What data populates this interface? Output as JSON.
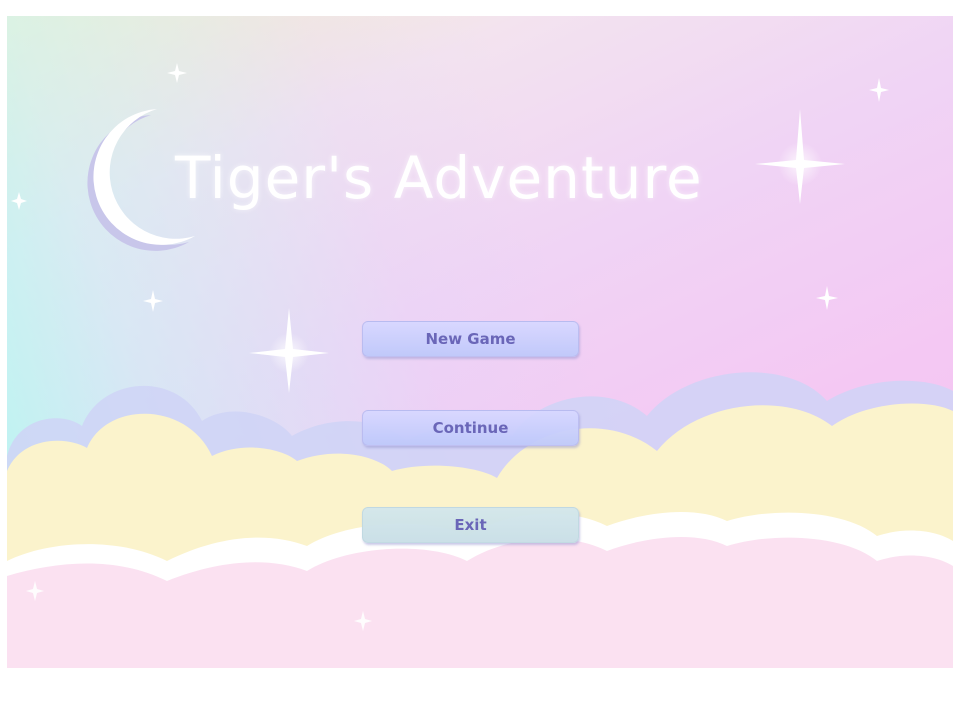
{
  "game": {
    "title": "Tiger's Adventure"
  },
  "menu": {
    "new_game": "New Game",
    "continue": "Continue",
    "exit": "Exit"
  },
  "colors": {
    "title_text": "#ffffff",
    "button_text": "#6a66b8",
    "cloud_blue": "#c9d0f5",
    "cloud_yellow": "#fbf4cf",
    "cloud_pink": "#fbe1f1"
  }
}
